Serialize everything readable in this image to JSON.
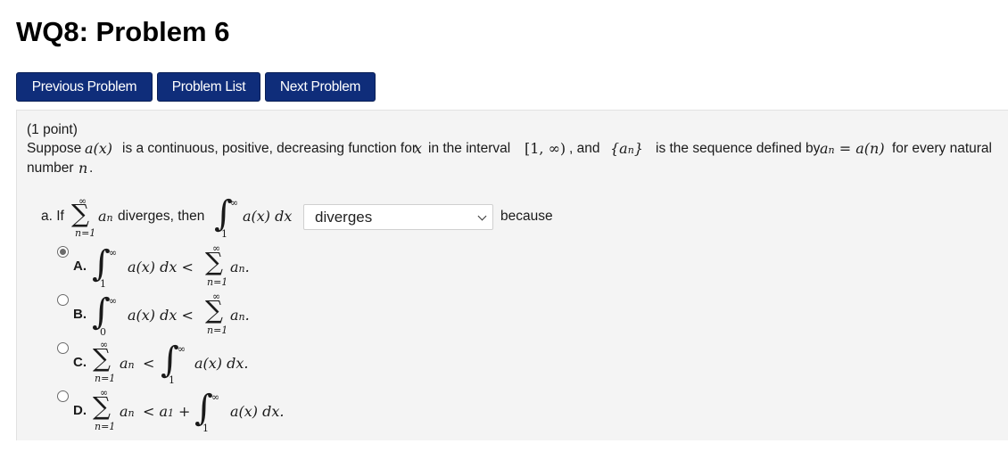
{
  "page": {
    "title": "WQ8: Problem 6"
  },
  "nav": {
    "previous_label": "Previous Problem",
    "list_label": "Problem List",
    "next_label": "Next Problem"
  },
  "problem": {
    "points": "(1 point)",
    "statement_1": "Suppose",
    "a_x": "a(x)",
    "statement_2": "is a continuous, positive, decreasing function for",
    "x": "x",
    "statement_3": "in the interval",
    "interval": "[1, ∞)",
    "statement_4": ", and",
    "seq": "{a",
    "seq_sub": "n",
    "seq_close": "}",
    "statement_5": "is the sequence defined by",
    "def_lhs": "a",
    "def_sub": "n",
    "def_rhs": "= a(n)",
    "statement_6": "for every natural",
    "statement_7": "number",
    "n": "n",
    "period": "."
  },
  "part_a": {
    "prefix": "a. If",
    "sum_upper": "∞",
    "sum_lower": "n=1",
    "a": "a",
    "a_sub": "n",
    "middle": "diverges, then",
    "int_upper": "∞",
    "int_lower": "1",
    "integrand": "a(x) dx",
    "select_value": "diverges",
    "suffix": "because"
  },
  "options": [
    {
      "letter": "A.",
      "selected": true,
      "int_lower": "1",
      "int_upper": "∞",
      "integrand": "a(x) dx <",
      "sum_upper": "∞",
      "sum_lower": "n=1",
      "a": "a",
      "a_sub": "n",
      "end": "."
    },
    {
      "letter": "B.",
      "selected": false,
      "int_lower": "0",
      "int_upper": "∞",
      "integrand": "a(x) dx <",
      "sum_upper": "∞",
      "sum_lower": "n=1",
      "a": "a",
      "a_sub": "n",
      "end": "."
    },
    {
      "letter": "C.",
      "selected": false,
      "sum_upper": "∞",
      "sum_lower": "n=1",
      "a": "a",
      "a_sub": "n",
      "lt": "<",
      "int_lower": "1",
      "int_upper": "∞",
      "integrand": "a(x) dx."
    },
    {
      "letter": "D.",
      "selected": false,
      "sum_upper": "∞",
      "sum_lower": "n=1",
      "a": "a",
      "a_sub": "n",
      "lt": "< a",
      "a1_sub": "1",
      "plus": "+",
      "int_lower": "1",
      "int_upper": "∞",
      "integrand": "a(x) dx."
    }
  ]
}
